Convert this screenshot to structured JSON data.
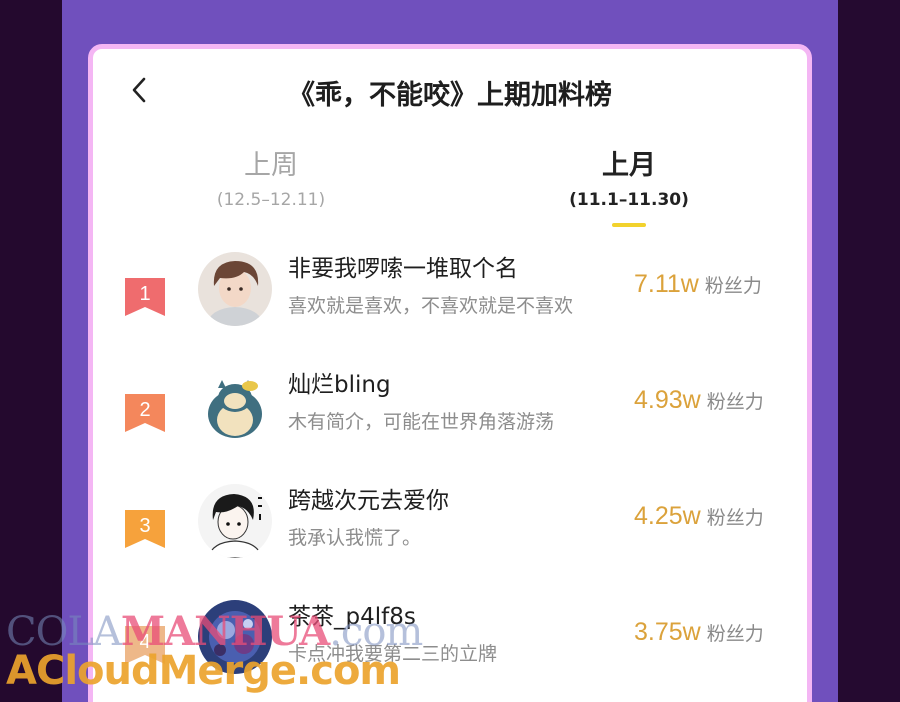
{
  "header": {
    "title": "《乖，不能咬》上期加料榜"
  },
  "tabs": [
    {
      "label": "上周",
      "range": "(12.5–12.11)",
      "active": false
    },
    {
      "label": "上月",
      "range": "(11.1–11.30)",
      "active": true
    }
  ],
  "ranking": [
    {
      "rank": "1",
      "name": "非要我啰嗦一堆取个名",
      "bio": "喜欢就是喜欢，不喜欢就是不喜欢",
      "amount": "7.11w",
      "unit": "粉丝力",
      "badge_color": "#ef6c6e",
      "avatar_icon": "avatar-boy-illustration"
    },
    {
      "rank": "2",
      "name": "灿烂bling",
      "bio": "木有简介，可能在世界角落游荡",
      "amount": "4.93w",
      "unit": "粉丝力",
      "badge_color": "#f4875c",
      "avatar_icon": "avatar-snorlax-illustration"
    },
    {
      "rank": "3",
      "name": "跨越次元去爱你",
      "bio": "我承认我慌了。",
      "amount": "4.25w",
      "unit": "粉丝力",
      "badge_color": "#f6a23c",
      "avatar_icon": "avatar-sketch-boy"
    },
    {
      "rank": "4",
      "name": "茶茶_p4lf8s",
      "bio": "卡点冲我要第二三的立牌",
      "amount": "3.75w",
      "unit": "粉丝力",
      "badge_color": "#eeb889",
      "avatar_icon": "avatar-dark-illustration"
    }
  ],
  "watermark": {
    "line1a": "COLA",
    "line1b": "MANHUA",
    "line1c": ".com",
    "line2": "ACloudMerge.com"
  },
  "colors": {
    "panel_border": "#f4b6f4",
    "background_purple": "#7050bd",
    "accent_underline": "#f2d22d",
    "amount": "#dba23b"
  }
}
